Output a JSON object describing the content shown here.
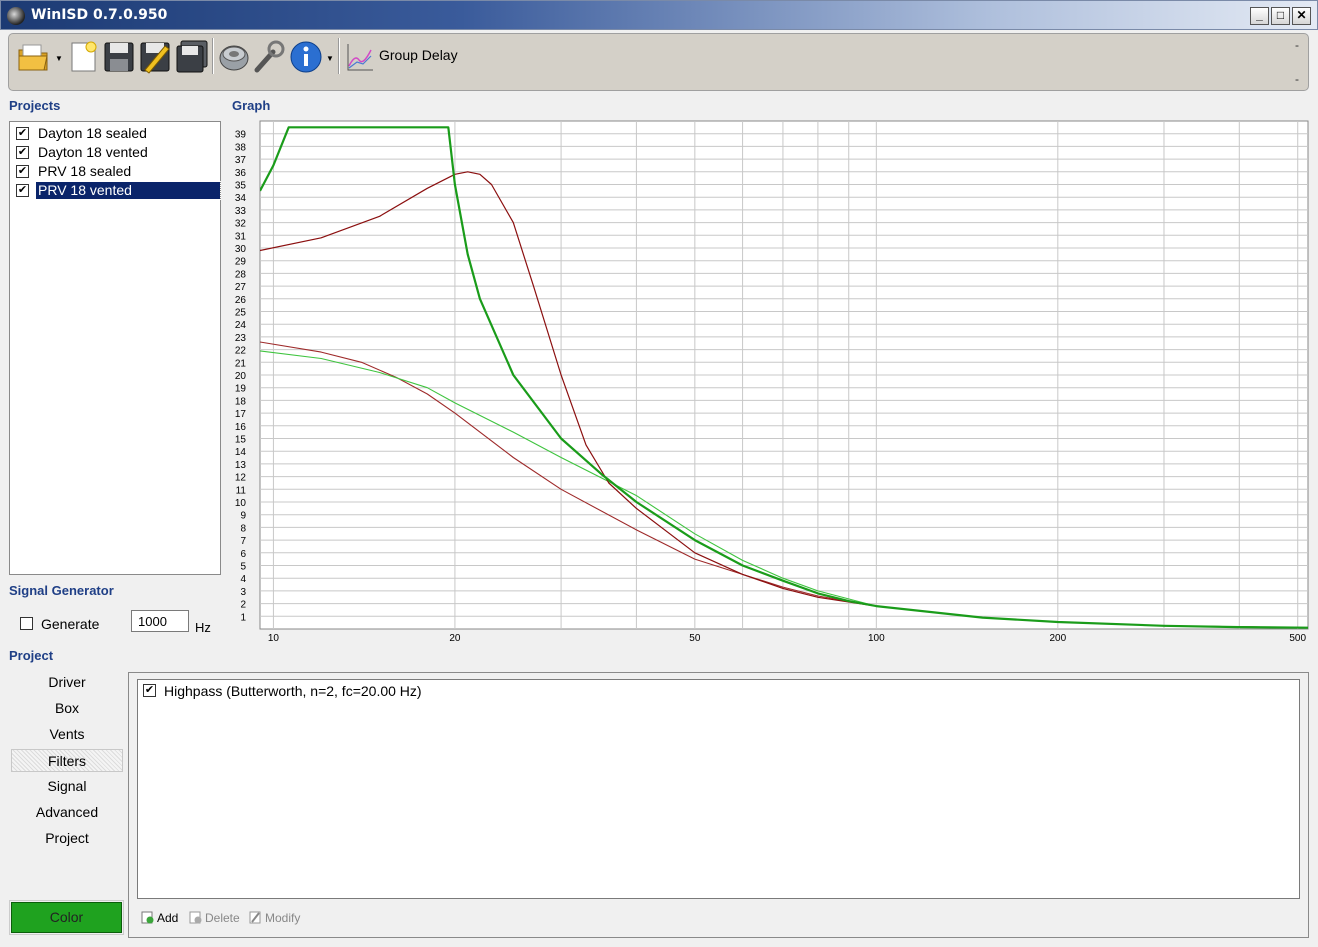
{
  "window": {
    "title": "WinISD 0.7.0.950"
  },
  "toolbar": {
    "group_delay_label": "Group Delay",
    "right_markers": [
      "-",
      "-"
    ],
    "icons": [
      "open-folder-icon",
      "new-document-icon",
      "save-icon",
      "save-as-icon",
      "save-all-icon",
      "driver-speaker-icon",
      "tools-wrench-icon",
      "info-icon",
      "graph-type-icon"
    ]
  },
  "projects": {
    "heading": "Projects",
    "items": [
      {
        "label": "Dayton 18 sealed",
        "checked": true
      },
      {
        "label": "Dayton 18 vented",
        "checked": true
      },
      {
        "label": "PRV 18 sealed",
        "checked": true
      },
      {
        "label": "PRV 18 vented",
        "checked": true,
        "selected": true
      }
    ]
  },
  "signal_generator": {
    "heading": "Signal Generator",
    "generate_label": "Generate",
    "generate_checked": false,
    "frequency_value": "1000",
    "unit": "Hz"
  },
  "graph": {
    "heading": "Graph"
  },
  "chart_data": {
    "type": "line",
    "title": "",
    "xlabel": "",
    "ylabel": "",
    "xscale": "log",
    "xlim": [
      9.5,
      520
    ],
    "ylim": [
      0,
      40
    ],
    "x_ticks": [
      10,
      20,
      50,
      100,
      200,
      500
    ],
    "y_ticks": [
      1,
      2,
      3,
      4,
      5,
      6,
      7,
      8,
      9,
      10,
      11,
      12,
      13,
      14,
      15,
      16,
      17,
      18,
      19,
      20,
      21,
      22,
      23,
      24,
      25,
      26,
      27,
      28,
      29,
      30,
      31,
      32,
      33,
      34,
      35,
      36,
      37,
      38,
      39
    ],
    "grid": true,
    "legend": "none",
    "series": [
      {
        "color": "#1a9c1a",
        "width": 2.2,
        "points": [
          [
            9.5,
            34.5
          ],
          [
            10,
            36.5
          ],
          [
            10.6,
            39.5
          ],
          [
            19.5,
            39.5
          ],
          [
            20,
            35
          ],
          [
            21,
            29.5
          ],
          [
            22,
            26
          ],
          [
            25,
            20
          ],
          [
            30,
            15
          ],
          [
            35,
            12.2
          ],
          [
            40,
            10
          ],
          [
            50,
            7
          ],
          [
            60,
            5
          ],
          [
            70,
            3.8
          ],
          [
            80,
            2.8
          ],
          [
            90,
            2.2
          ],
          [
            100,
            1.8
          ],
          [
            150,
            0.9
          ],
          [
            200,
            0.55
          ],
          [
            300,
            0.25
          ],
          [
            400,
            0.15
          ],
          [
            520,
            0.1
          ]
        ]
      },
      {
        "color": "#8b0f0f",
        "width": 1.2,
        "points": [
          [
            9.5,
            29.8
          ],
          [
            12,
            30.8
          ],
          [
            15,
            32.5
          ],
          [
            18,
            34.7
          ],
          [
            20,
            35.8
          ],
          [
            21,
            36
          ],
          [
            22,
            35.8
          ],
          [
            23,
            35
          ],
          [
            25,
            32
          ],
          [
            27,
            27
          ],
          [
            30,
            20
          ],
          [
            33,
            14.5
          ],
          [
            36,
            11.5
          ],
          [
            40,
            9.5
          ],
          [
            50,
            6
          ],
          [
            60,
            4.3
          ],
          [
            70,
            3.2
          ],
          [
            80,
            2.5
          ],
          [
            100,
            1.8
          ],
          [
            150,
            0.9
          ],
          [
            200,
            0.55
          ],
          [
            300,
            0.25
          ],
          [
            520,
            0.1
          ]
        ]
      },
      {
        "color": "#9e2a2a",
        "width": 1.1,
        "points": [
          [
            9.5,
            22.6
          ],
          [
            12,
            21.8
          ],
          [
            14,
            21
          ],
          [
            16,
            19.8
          ],
          [
            18,
            18.5
          ],
          [
            20,
            17
          ],
          [
            25,
            13.5
          ],
          [
            30,
            11
          ],
          [
            40,
            7.8
          ],
          [
            50,
            5.5
          ],
          [
            60,
            4.3
          ],
          [
            70,
            3.3
          ],
          [
            80,
            2.6
          ],
          [
            100,
            1.8
          ],
          [
            150,
            0.9
          ],
          [
            200,
            0.55
          ],
          [
            300,
            0.25
          ],
          [
            520,
            0.1
          ]
        ]
      },
      {
        "color": "#3fc43f",
        "width": 1.1,
        "points": [
          [
            9.5,
            21.9
          ],
          [
            12,
            21.3
          ],
          [
            15,
            20.2
          ],
          [
            18,
            19
          ],
          [
            20,
            17.8
          ],
          [
            25,
            15.5
          ],
          [
            30,
            13.5
          ],
          [
            40,
            10.5
          ],
          [
            50,
            7.5
          ],
          [
            60,
            5.4
          ],
          [
            70,
            4
          ],
          [
            80,
            3
          ],
          [
            100,
            1.8
          ],
          [
            150,
            0.9
          ],
          [
            200,
            0.55
          ],
          [
            300,
            0.25
          ],
          [
            520,
            0.1
          ]
        ]
      }
    ]
  },
  "project": {
    "heading": "Project",
    "nav": [
      "Driver",
      "Box",
      "Vents",
      "Filters",
      "Signal",
      "Advanced",
      "Project"
    ],
    "active_nav": "Filters",
    "color_button": "Color",
    "color_value": "#1fa21f"
  },
  "filters": {
    "items": [
      {
        "label": "Highpass (Butterworth, n=2, fc=20.00 Hz)",
        "checked": true
      }
    ],
    "add_label": "Add",
    "delete_label": "Delete",
    "modify_label": "Modify"
  }
}
